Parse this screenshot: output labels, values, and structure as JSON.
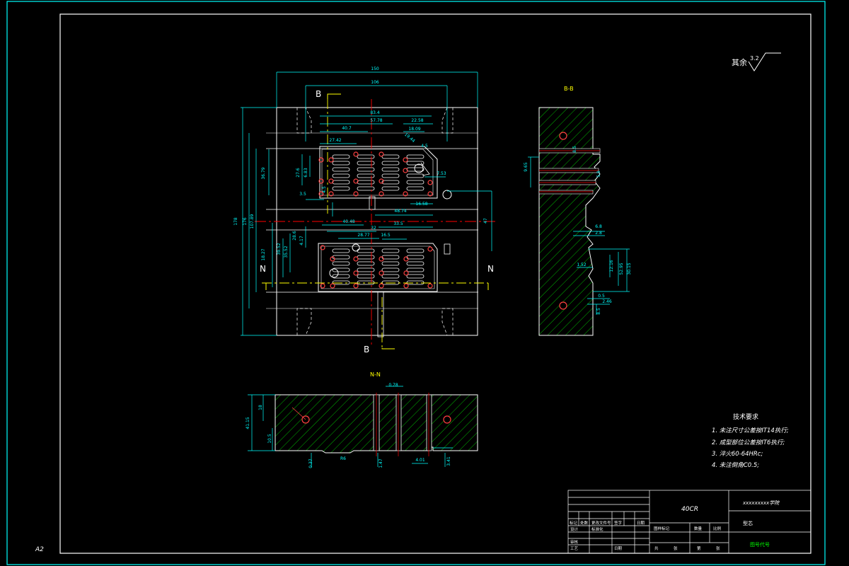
{
  "sheet": {
    "size_label": "A2"
  },
  "roughness": {
    "prefix": "其余",
    "value": "3.2"
  },
  "views": {
    "section_bb_label": "B-B",
    "section_nn_label": "N-N",
    "cut_b": "B",
    "cut_n": "N"
  },
  "dimensions": {
    "plan": [
      "150",
      "106",
      "83.4",
      "57.78",
      "40.7",
      "27.42",
      "22.58",
      "18.09",
      "19.44",
      "4.5",
      "4.5",
      "7.53",
      "16.58",
      "48.74",
      "40.48",
      "32",
      "28.77",
      "33.5",
      "16.5",
      "27.6",
      "6.83",
      "3.5",
      "36.79",
      "178",
      "176",
      "107.89",
      "18.27",
      "39.52",
      "35.52",
      "28.6",
      "4.17",
      "47"
    ],
    "section_bb": [
      "6.8",
      "2.8",
      "12.16",
      "52.95",
      "30.15",
      "1.52",
      "0.5",
      "2.46",
      "8.5",
      "8.5",
      "9.65",
      "5.9"
    ],
    "section_nn": [
      "41.15",
      "18",
      "10.5",
      "0.37",
      "1.47",
      "4.01",
      "0.78",
      "3.41",
      "R6"
    ]
  },
  "material": "40CR",
  "tech_requirements": {
    "title": "技术要求",
    "items": [
      "1. 未注尺寸公差按IT14执行;",
      "2. 成型部位公差按IT6执行;",
      "3. 淬火60-64HRc;",
      "4. 未注倒角C0.5;"
    ]
  },
  "title_block": {
    "school": "xxxxxxxxx学院",
    "part_name": "型芯",
    "material_cell": "40CR",
    "sign_headers": [
      "标记",
      "处数",
      "更改文件号",
      "签字",
      "日期"
    ],
    "role_rows": [
      "设计",
      "审核",
      "工艺"
    ],
    "row_extra": [
      "标准化",
      "日期"
    ],
    "stage_headers": [
      "图样标记",
      "数量",
      "比例"
    ],
    "sheet_row": [
      "共",
      "张",
      "第",
      "张"
    ],
    "drawing_number": "图号代号"
  },
  "colors": {
    "border": "#00ffff",
    "outline": "#ffffff",
    "dimension": "#00ffff",
    "hatch": "#00c000",
    "center_line": "#ff0000",
    "pin_hole": "#ff4040",
    "cut_plane": "#ffff00",
    "annotation": "#ffffff"
  }
}
